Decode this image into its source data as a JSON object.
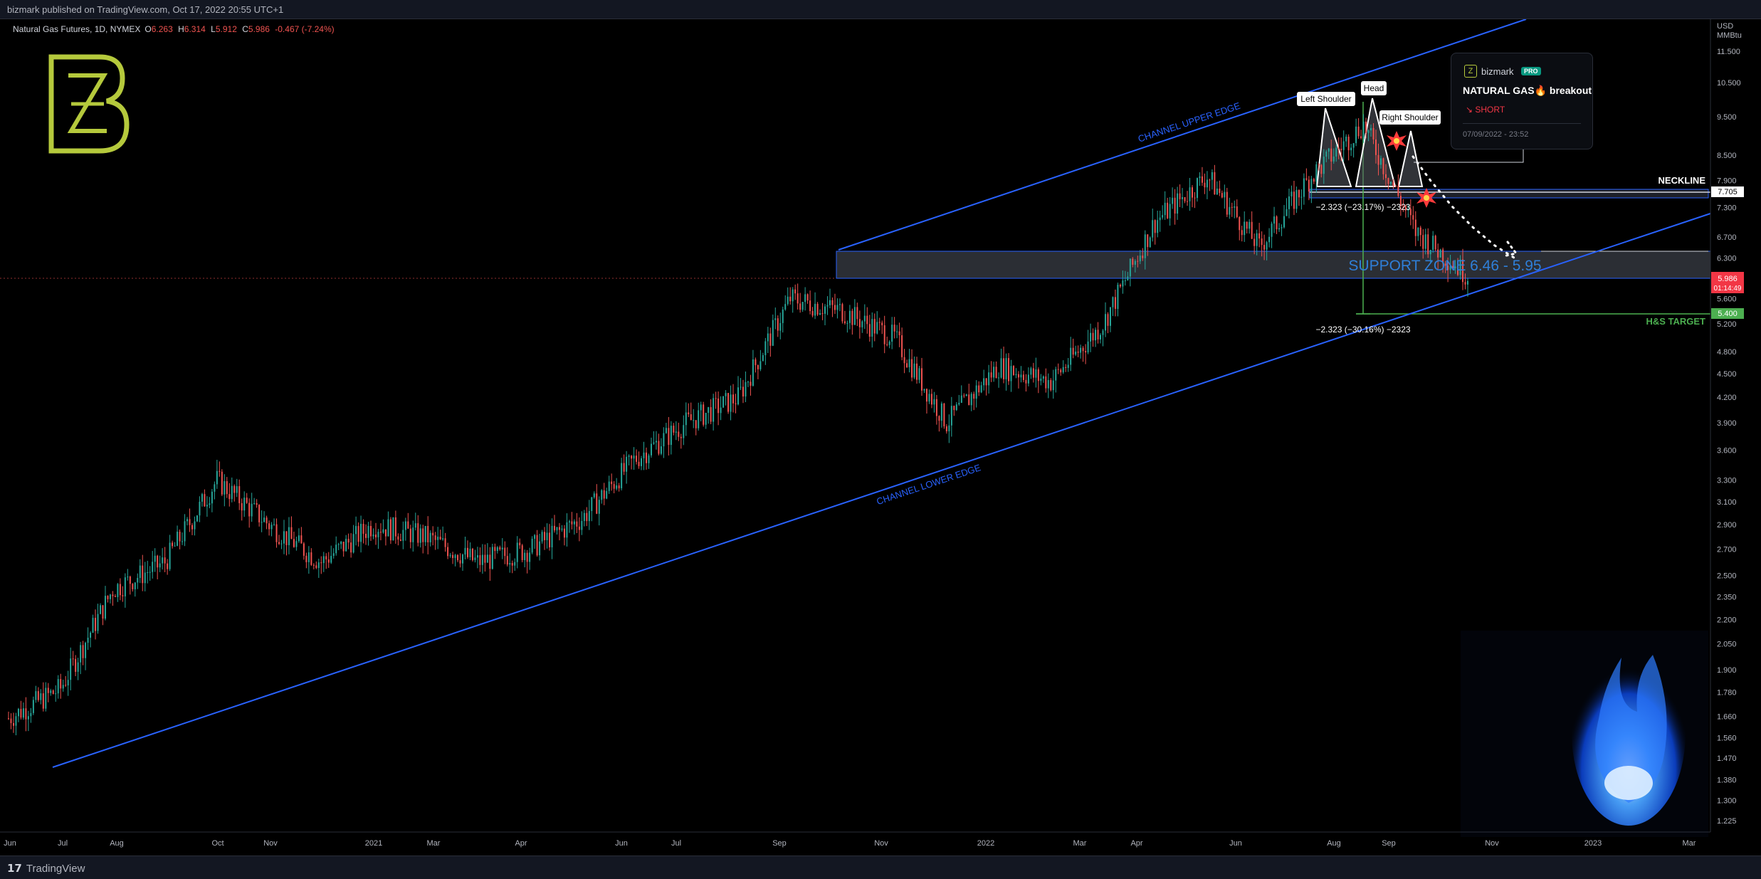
{
  "header": {
    "published": "bizmark published on TradingView.com, Oct 17, 2022 20:55 UTC+1"
  },
  "ohlc": {
    "symbol": "Natural Gas Futures, 1D, NYMEX",
    "o_label": "O",
    "o": "6.263",
    "h_label": "H",
    "h": "6.314",
    "l_label": "L",
    "l": "5.912",
    "c_label": "C",
    "c": "5.986",
    "change": "-0.467 (-7.24%)"
  },
  "axis_unit": [
    "USD",
    "MMBtu"
  ],
  "price_ticks": [
    "11.500",
    "10.500",
    "9.500",
    "8.500",
    "7.900",
    "7.300",
    "6.700",
    "6.300",
    "5.600",
    "5.200",
    "4.800",
    "4.500",
    "4.200",
    "3.900",
    "3.600",
    "3.300",
    "3.100",
    "2.900",
    "2.700",
    "2.500",
    "2.350",
    "2.200",
    "2.050",
    "1.900",
    "1.780",
    "1.660",
    "1.560",
    "1.470",
    "1.380",
    "1.300",
    "1.225"
  ],
  "time_ticks": [
    "Jun",
    "Jul",
    "Aug",
    "Oct",
    "Nov",
    "2021",
    "Mar",
    "Apr",
    "Jun",
    "Jul",
    "Sep",
    "Nov",
    "2022",
    "Mar",
    "Apr",
    "Jun",
    "Aug",
    "Sep",
    "Nov",
    "2023",
    "Mar"
  ],
  "price_labels": {
    "neckline": "7.705",
    "last_price": "5.986",
    "countdown": "01:14:49",
    "target": "5.400"
  },
  "annotations": {
    "channel_upper": "CHANNEL UPPER EDGE",
    "channel_lower": "CHANNEL LOWER EDGE",
    "left_shoulder": "Left Shoulder",
    "head": "Head",
    "right_shoulder": "Right Shoulder",
    "neckline": "NECKLINE",
    "support_zone": "SUPPORT ZONE 6.46 - 5.95",
    "hs_target": "H&S TARGET",
    "measure_1": "−2.323 (−23.17%) −2323",
    "measure_2": "−2.323 (−30.16%) −2323"
  },
  "idea_card": {
    "author": "bizmark",
    "badge": "PRO",
    "title": "NATURAL GAS🔥 breakout",
    "direction": "↘ SHORT",
    "date": "07/09/2022 - 23:52"
  },
  "footer": {
    "brand": "TradingView"
  },
  "colors": {
    "background": "#000000",
    "bull": "#26a69a",
    "bear": "#ef5350",
    "channel": "#2962ff",
    "support_text": "#2f7fd8",
    "target": "#4caf50",
    "logo": "#b5c93c",
    "last_price_bg": "#f23645"
  },
  "chart_data": {
    "type": "candlestick",
    "title": "Natural Gas Futures, 1D, NYMEX",
    "scale": "log",
    "ylim": [
      1.225,
      11.5
    ],
    "xlabel": "",
    "ylabel": "",
    "series": [
      {
        "name": "",
        "x": [
          "2020-06",
          "2020-07",
          "2020-08",
          "2020-09",
          "2020-10",
          "2020-11",
          "2020-12",
          "2021-01",
          "2021-02",
          "2021-03",
          "2021-04",
          "2021-05",
          "2021-06",
          "2021-07",
          "2021-08",
          "2021-09",
          "2021-10",
          "2021-11",
          "2021-12",
          "2022-01",
          "2022-02",
          "2022-03",
          "2022-04",
          "2022-05",
          "2022-06",
          "2022-07",
          "2022-08",
          "2022-09",
          "2022-10"
        ],
        "values": [
          1.65,
          1.8,
          2.4,
          2.6,
          3.3,
          2.9,
          2.6,
          2.9,
          2.8,
          2.6,
          2.7,
          2.95,
          3.5,
          3.9,
          4.2,
          5.6,
          5.4,
          5.0,
          3.9,
          4.6,
          4.4,
          5.2,
          7.0,
          8.0,
          6.5,
          8.0,
          9.3,
          6.8,
          5.99
        ]
      }
    ],
    "channel": {
      "upper": [
        [
          "2021-09",
          6.3
        ],
        [
          "2022-10",
          13.5
        ]
      ],
      "lower": [
        [
          "2020-07",
          1.45
        ],
        [
          "2023-01",
          7.2
        ]
      ]
    },
    "support_zone": [
      5.95,
      6.46
    ],
    "neckline": 7.705,
    "target": 5.4
  }
}
